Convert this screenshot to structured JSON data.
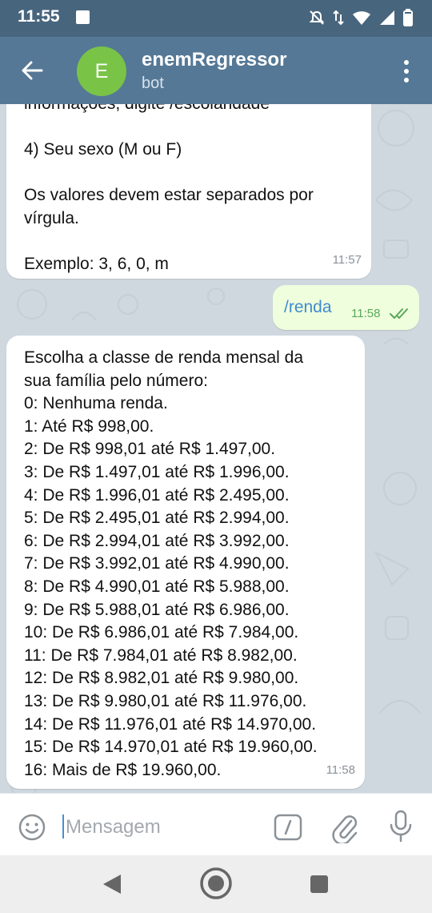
{
  "status_bar": {
    "time": "11:55",
    "icons": [
      "photo-icon",
      "mute-icon",
      "data-arrows-icon",
      "wifi-icon",
      "signal-icon",
      "battery-icon"
    ]
  },
  "app_bar": {
    "back_icon": "arrow-left-icon",
    "avatar_letter": "E",
    "avatar_color": "#79c347",
    "title": "enemRegressor",
    "subtitle": "bot",
    "menu_icon": "more-vertical-icon"
  },
  "messages": [
    {
      "direction": "in",
      "lines": [
        "informações, digite /escolaridade",
        "",
        "4) Seu sexo (M ou F)",
        "",
        "Os valores devem estar separados por",
        "vírgula.",
        "",
        "Exemplo: 3, 6, 0, m"
      ],
      "time": "11:57"
    },
    {
      "direction": "out",
      "text": "/renda",
      "time": "11:58",
      "status_icon": "double-check-icon"
    },
    {
      "direction": "in",
      "lines": [
        "Escolha a classe de renda mensal da",
        "sua família pelo número:",
        "0: Nenhuma renda.",
        "1: Até R$ 998,00.",
        "2: De R$ 998,01 até R$ 1.497,00.",
        "3: De R$ 1.497,01 até R$ 1.996,00.",
        "4: De R$ 1.996,01 até R$ 2.495,00.",
        "5: De R$ 2.495,01 até R$ 2.994,00.",
        "6: De R$ 2.994,01 até R$ 3.992,00.",
        "7: De R$ 3.992,01 até R$ 4.990,00.",
        "8: De R$ 4.990,01 até R$ 5.988,00.",
        "9: De R$ 5.988,01 até R$ 6.986,00.",
        "10: De R$ 6.986,01 até R$ 7.984,00.",
        "11: De R$ 7.984,01 até R$ 8.982,00.",
        "12: De R$ 8.982,01 até R$ 9.980,00.",
        "13: De R$ 9.980,01 até R$ 11.976,00.",
        "14: De R$ 11.976,01 até R$ 14.970,00.",
        "15: De R$ 14.970,01 até R$ 19.960,00.",
        "16: Mais de R$ 19.960,00."
      ],
      "time": "11:58"
    }
  ],
  "input_bar": {
    "placeholder": "Mensagem",
    "icons": [
      "emoji-icon",
      "slash-command-icon",
      "paperclip-icon",
      "microphone-icon"
    ]
  },
  "nav_bar": {
    "icons": [
      "nav-back-icon",
      "nav-home-icon",
      "nav-recents-icon"
    ]
  },
  "colors": {
    "status_bar": "#48657e",
    "app_bar": "#557896",
    "chat_background": "#cfd8df",
    "incoming_bubble": "#ffffff",
    "outgoing_bubble": "#effedd",
    "outgoing_text": "#3f8bd0",
    "read_ticks": "#5aa85b"
  }
}
